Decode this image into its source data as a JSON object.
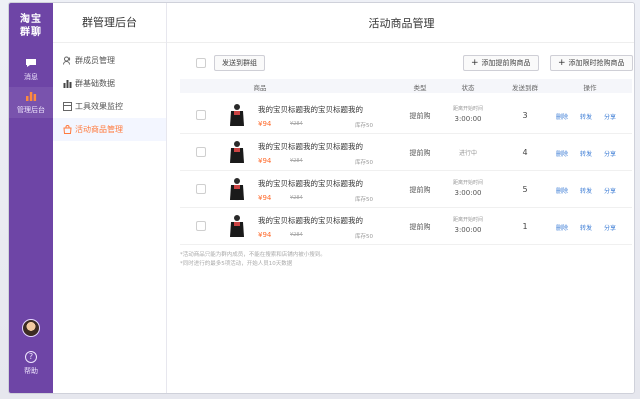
{
  "brand": {
    "line1": "淘宝",
    "line2": "群聊"
  },
  "leftnav": [
    {
      "label": "消息",
      "icon": "chat-icon"
    },
    {
      "label": "管理后台",
      "icon": "bar-chart-icon"
    }
  ],
  "help_label": "帮助",
  "sidebar": {
    "title": "群管理后台",
    "items": [
      {
        "label": "群成员管理",
        "icon": "members-icon"
      },
      {
        "label": "群基础数据",
        "icon": "stats-icon"
      },
      {
        "label": "工具效果监控",
        "icon": "monitor-icon"
      },
      {
        "label": "活动商品管理",
        "icon": "bag-icon",
        "active": true
      }
    ]
  },
  "main": {
    "title": "活动商品管理",
    "send_button": "发送到群组",
    "add_presale_button": "添加提前购商品",
    "add_flash_button": "添加限时抢购商品",
    "columns": [
      "商品",
      "类型",
      "状态",
      "发送到群",
      "操作"
    ],
    "rows": [
      {
        "title": "我的宝贝标题我的宝贝标题我的",
        "price": "¥94",
        "oprice": "¥284",
        "stock": "库存50",
        "type": "提前购",
        "status_top": "距离开始时间",
        "status_main": "3:00:00",
        "count": "3",
        "ops": [
          "删除",
          "转发",
          "分享"
        ]
      },
      {
        "title": "我的宝贝标题我的宝贝标题我的",
        "price": "¥94",
        "oprice": "¥284",
        "stock": "库存50",
        "type": "提前购",
        "status_top": "",
        "status_main": "进行中",
        "count": "4",
        "ops": [
          "删除",
          "转发",
          "分享"
        ]
      },
      {
        "title": "我的宝贝标题我的宝贝标题我的",
        "price": "¥94",
        "oprice": "¥284",
        "stock": "库存50",
        "type": "提前购",
        "status_top": "距离开始时间",
        "status_main": "3:00:00",
        "count": "5",
        "ops": [
          "删除",
          "转发",
          "分享"
        ]
      },
      {
        "title": "我的宝贝标题我的宝贝标题我的",
        "price": "¥94",
        "oprice": "¥284",
        "stock": "库存50",
        "type": "提前购",
        "status_top": "距离开始时间",
        "status_main": "3:00:00",
        "count": "1",
        "ops": [
          "删除",
          "转发",
          "分享"
        ]
      }
    ],
    "notes": [
      "*活动商品只能为群内成员，不能在搜索和店铺内被小搜到。",
      "*同时进行的最多5项活动，开始人员10天数据"
    ]
  },
  "colors": {
    "sidebar_bg": "#6e45a6",
    "accent_orange": "#ff7a3d",
    "link_blue": "#3a7bd5"
  }
}
